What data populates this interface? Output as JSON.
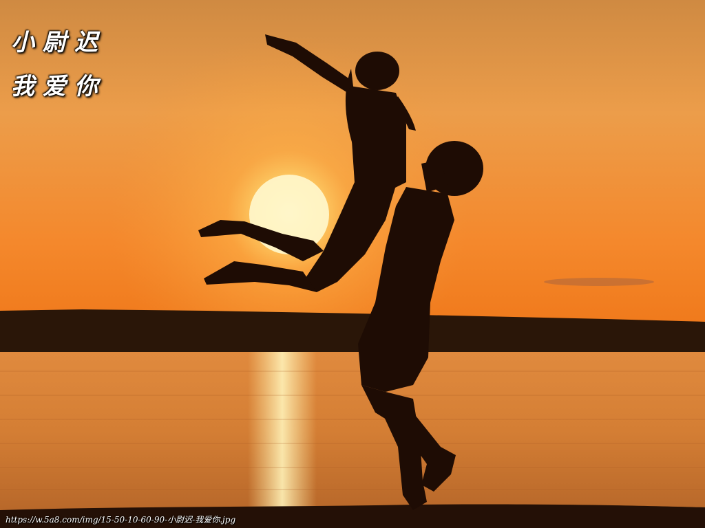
{
  "caption": {
    "line1": "小尉迟",
    "line2": "我爱你"
  },
  "watermark": {
    "text": "https://w.5a8.com/img/15-50-10-60-90-小尉迟-我爱你.jpg"
  },
  "colors": {
    "sky_top": "#d9923e",
    "sky_mid": "#f0a24a",
    "horizon": "#f27b1a",
    "sun": "#fff6c8",
    "water": "#d9843a",
    "silhouette": "#1e0c04",
    "treeline": "#2a1608"
  }
}
